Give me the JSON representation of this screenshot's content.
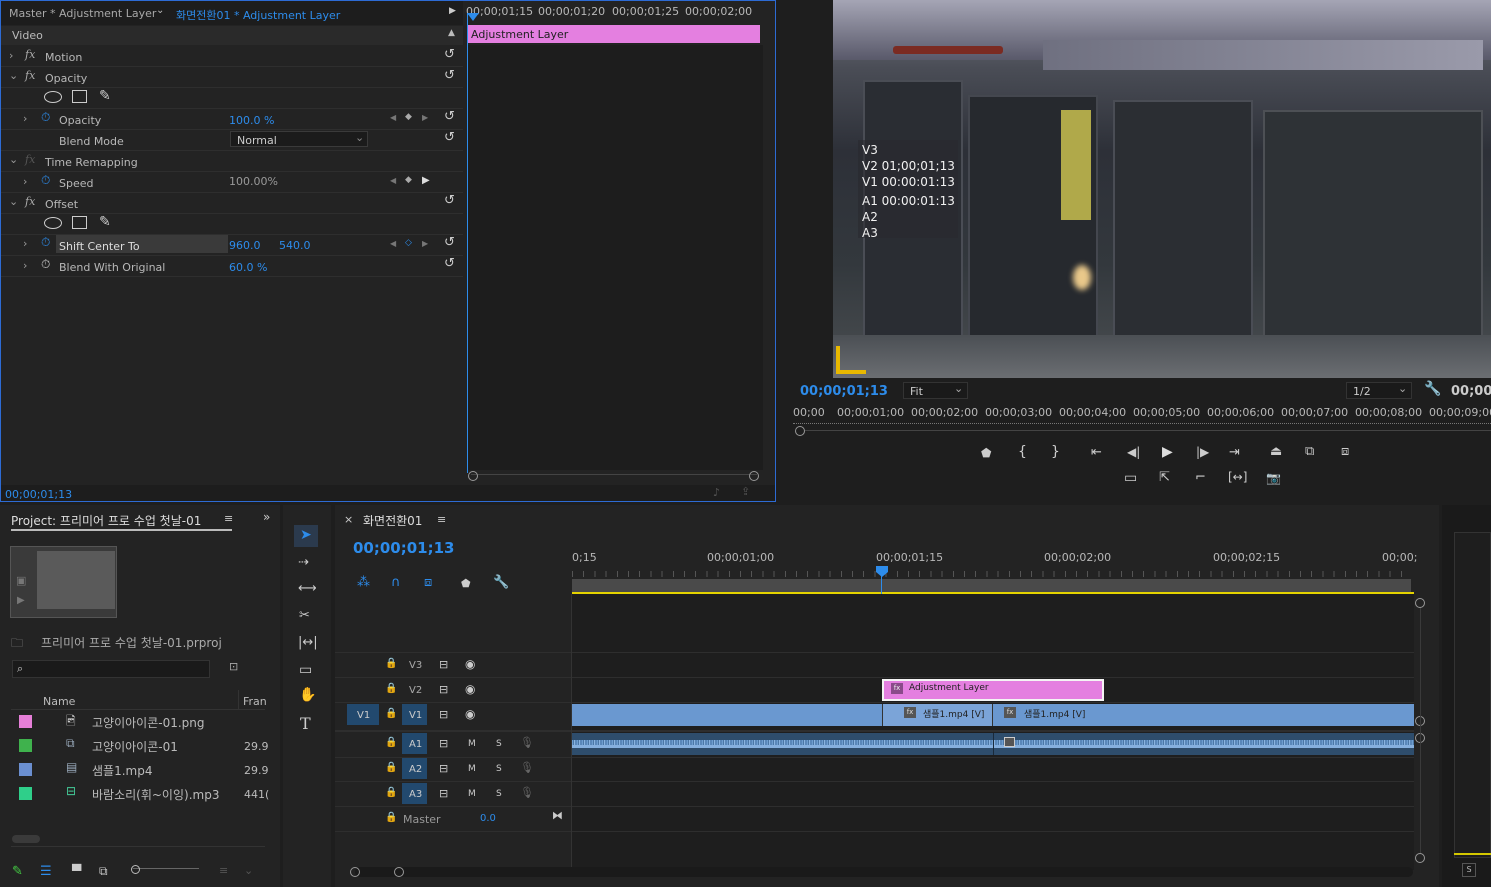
{
  "effect_controls": {
    "master_label": "Master * Adjustment Layer",
    "sequence_label": "화면전환01 * Adjustment Layer",
    "ruler_times": [
      "00;00;01;15",
      "00;00;01;20",
      "00;00;01;25",
      "00;00;02;00"
    ],
    "clip_bar_label": "Adjustment Layer",
    "clip_bar_color": "#e47fe0",
    "section_video": "Video",
    "motion": "Motion",
    "opacity_group": "Opacity",
    "opacity_param": "Opacity",
    "opacity_value": "100.0 %",
    "blend_mode_label": "Blend Mode",
    "blend_mode_value": "Normal",
    "time_remapping": "Time Remapping",
    "speed_label": "Speed",
    "speed_value": "100.00%",
    "offset_group": "Offset",
    "shift_center_label": "Shift Center To",
    "shift_x": "960.0",
    "shift_y": "540.0",
    "blend_original_label": "Blend With Original",
    "blend_original_value": "60.0 %",
    "footer_time": "00;00;01;13"
  },
  "program_monitor": {
    "overlay_lines": [
      "V3",
      "V2 01;00;01;13",
      "V1 00:00:01:13",
      "A1 00:00:01:13",
      "A2",
      "A3"
    ],
    "timecode": "00;00;01;13",
    "zoom": "Fit",
    "resolution": "1/2",
    "end_timecode": "00;00;",
    "ruler": [
      "00;00",
      "00;00;01;00",
      "00;00;02;00",
      "00;00;03;00",
      "00;00;04;00",
      "00;00;05;00",
      "00;00;06;00",
      "00;00;07;00",
      "00;00;08;00",
      "00;00;09;00"
    ],
    "playhead_fraction": 0.16
  },
  "project": {
    "tab_title": "Project: 프리미어 프로 수업 첫날-01",
    "file_name": "프리미어 프로 수업 첫날-01.prproj",
    "search_placeholder": "",
    "col_name": "Name",
    "col_fr": "Fran",
    "items": [
      {
        "name": "고양이아이콘-01.png",
        "fr": "",
        "color": "#e67fd8"
      },
      {
        "name": "고양이아이콘-01",
        "fr": "29.9",
        "color": "#3fb24d"
      },
      {
        "name": "샘플1.mp4",
        "fr": "29.9",
        "color": "#6b8fd0"
      },
      {
        "name": "바람소리(휘~이잉).mp3",
        "fr": "441(",
        "color": "#2fcf8a"
      }
    ]
  },
  "timeline": {
    "tab_title": "화면전환01",
    "timecode": "00;00;01;13",
    "ruler": [
      "0;15",
      "00;00;01;00",
      "00;00;01;15",
      "00;00;02;00",
      "00;00;02;15",
      "00;00;"
    ],
    "tracks_video": [
      "V3",
      "V2",
      "V1"
    ],
    "tracks_audio": [
      "A1",
      "A2",
      "A3"
    ],
    "source_v1": "V1",
    "master_label": "Master",
    "master_value": "0.0",
    "mute": "M",
    "solo": "S",
    "adjustment_clip": "Adjustment Layer",
    "clip_a": "샘플1.mp4 [V]",
    "clip_b": "샘플1.mp4 [V]",
    "adjustment_color": "#e47fe0",
    "video_clip_color": "#6a98d0"
  },
  "audio_meter": {
    "label": "S"
  }
}
